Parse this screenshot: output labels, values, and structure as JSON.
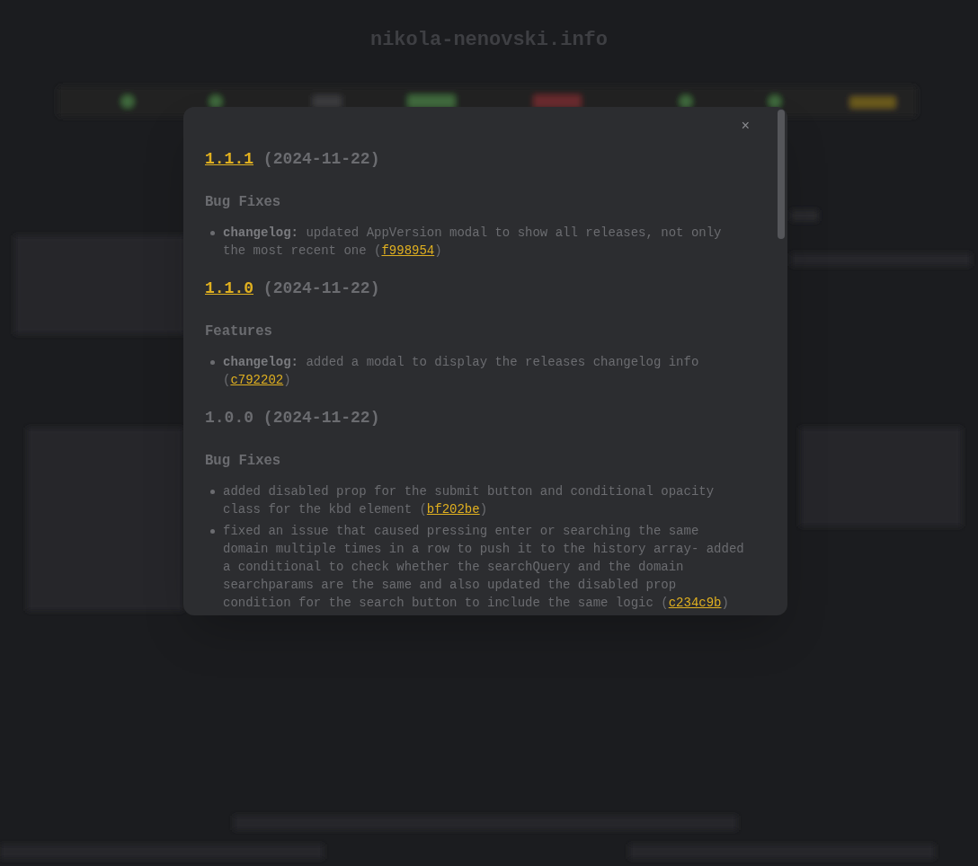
{
  "page": {
    "title": "nikola-nenovski.info"
  },
  "modal": {
    "close": "×",
    "releases": [
      {
        "version": "1.1.1",
        "linked": true,
        "date": "(2024-11-22)",
        "sections": [
          {
            "title": "Bug Fixes",
            "items": [
              {
                "scope": "changelog:",
                "text": "updated AppVersion modal to show all releases, not only the most recent one (",
                "commit": "f998954",
                "after": ")"
              }
            ]
          }
        ]
      },
      {
        "version": "1.1.0",
        "linked": true,
        "date": "(2024-11-22)",
        "sections": [
          {
            "title": "Features",
            "items": [
              {
                "scope": "changelog:",
                "text": "added a modal to display the releases changelog info (",
                "commit": "c792202",
                "after": ")"
              }
            ]
          }
        ]
      },
      {
        "version": "1.0.0",
        "linked": false,
        "date": "(2024-11-22)",
        "sections": [
          {
            "title": "Bug Fixes",
            "items": [
              {
                "text": "added disabled prop for the submit button and conditional opacity class for the kbd element (",
                "commit": "bf202be",
                "after": ")"
              },
              {
                "text": "fixed an issue that caused pressing enter or searching the same domain multiple times in a row to push it to the history array- added a conditional to check whether the searchQuery and the domain searchparams are the same and also updated the disabled prop condition for the search button to include the same logic (",
                "commit": "c234c9b",
                "after": ")"
              }
            ]
          }
        ]
      }
    ]
  }
}
